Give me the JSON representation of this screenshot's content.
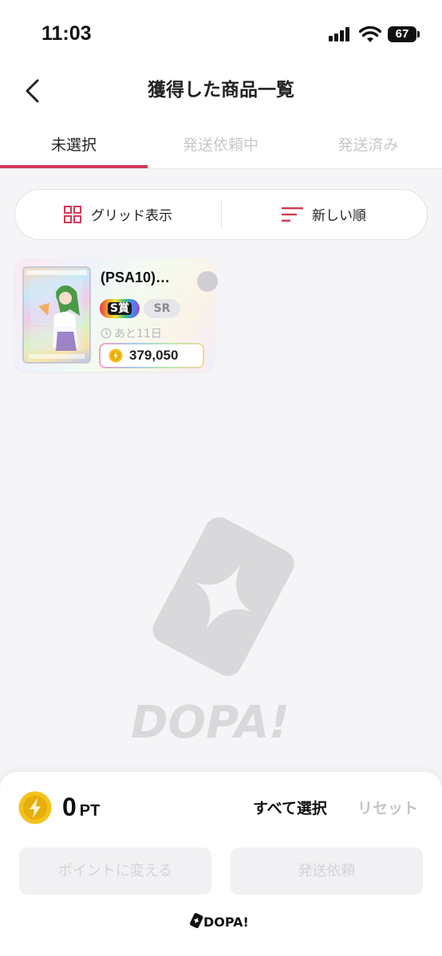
{
  "status_bar": {
    "time": "11:03",
    "battery": "67"
  },
  "header": {
    "title": "獲得した商品一覧"
  },
  "tabs": [
    {
      "label": "未選択",
      "active": true
    },
    {
      "label": "発送依頼中",
      "active": false
    },
    {
      "label": "発送済み",
      "active": false
    }
  ],
  "toolbar": {
    "view_label": "グリッド表示",
    "sort_label": "新しい順"
  },
  "items": [
    {
      "title": "(PSA10)…",
      "grade_badge": "S賞",
      "rarity_badge": "SR",
      "expiry": "あと11日",
      "price": "379,050"
    }
  ],
  "watermark_text": "DOPA!",
  "bottom_panel": {
    "points_value": "0",
    "points_unit": "PT",
    "select_all_label": "すべて選択",
    "reset_label": "リセット",
    "convert_button": "ポイントに変える",
    "ship_button": "発送依頼",
    "footer_logo": "DOPA!"
  },
  "colors": {
    "accent": "#d23a55",
    "coin": "#f3c21c",
    "inactive_text": "#c8c8c8",
    "background": "#f5f5f7"
  }
}
